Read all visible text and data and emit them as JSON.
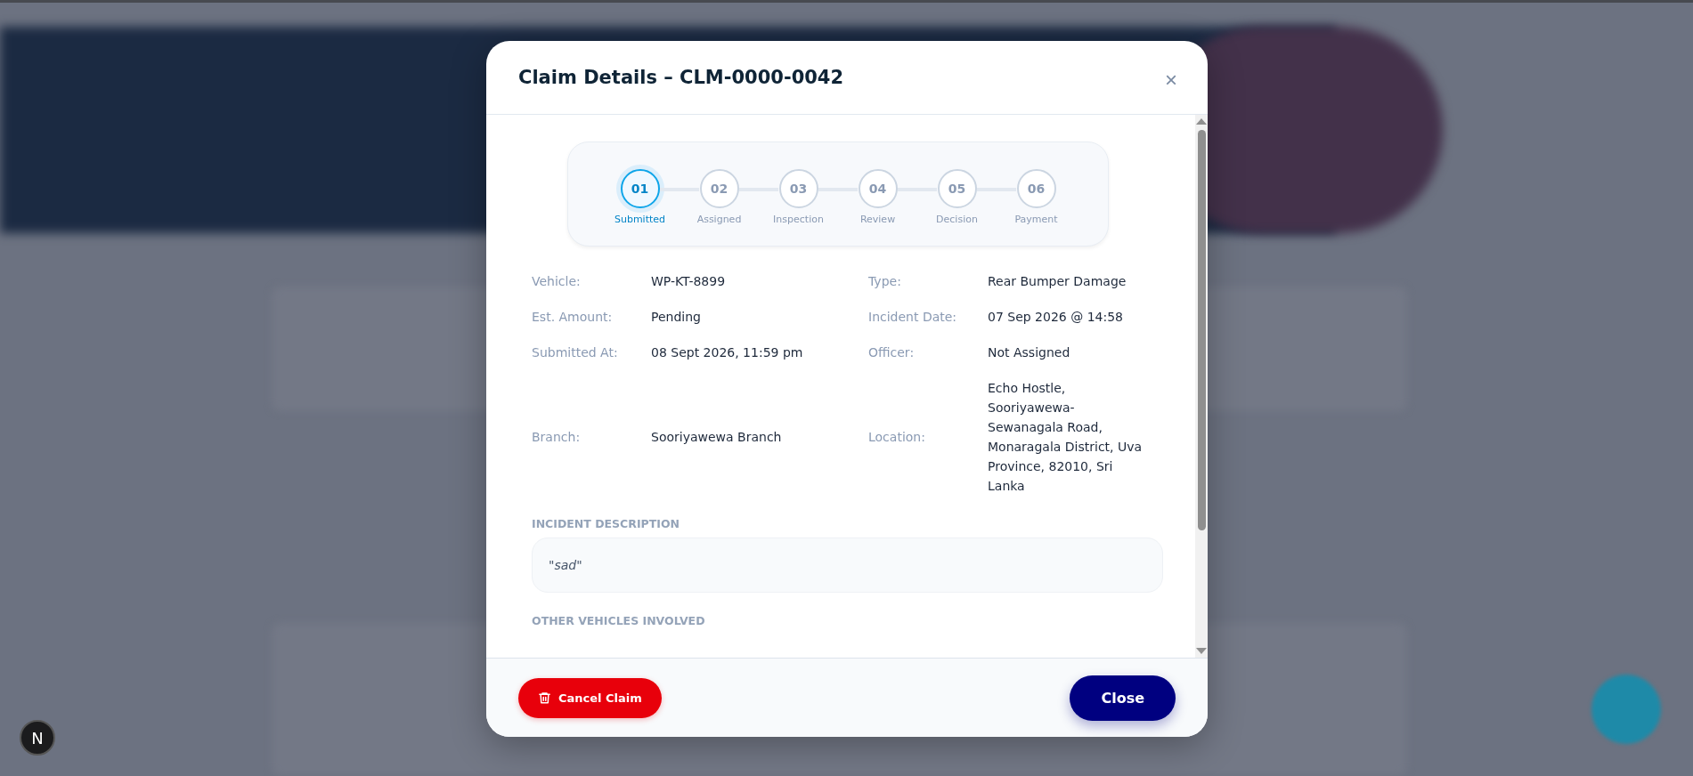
{
  "dev_badge": "N",
  "modal": {
    "title": "Claim Details – CLM-0000-0042",
    "close_icon": "×",
    "steps": [
      {
        "number": "01",
        "label": "Submitted",
        "selected": true
      },
      {
        "number": "02",
        "label": "Assigned",
        "selected": false
      },
      {
        "number": "03",
        "label": "Inspection",
        "selected": false
      },
      {
        "number": "04",
        "label": "Review",
        "selected": false
      },
      {
        "number": "05",
        "label": "Decision",
        "selected": false
      },
      {
        "number": "06",
        "label": "Payment",
        "selected": false
      }
    ],
    "details": [
      [
        {
          "label": "Vehicle:",
          "value": "WP-KT-8899"
        },
        {
          "label": "Type:",
          "value": "Rear Bumper Damage"
        }
      ],
      [
        {
          "label": "Est. Amount:",
          "value": "Pending"
        },
        {
          "label": "Incident Date:",
          "value": "07 Sep 2026 @ 14:58"
        }
      ],
      [
        {
          "label": "Submitted At:",
          "value": "08 Sept 2026, 11:59 pm"
        },
        {
          "label": "Officer:",
          "value": "Not Assigned"
        }
      ],
      [
        {
          "label": "Branch:",
          "value": "Sooriyawewa Branch"
        },
        {
          "label": "Location:",
          "value": "Echo Hostle, Sooriyawewa-Sewanagala Road, Monaragala District, Uva Province, 82010, Sri Lanka"
        }
      ]
    ],
    "description_heading": "INCIDENT DESCRIPTION",
    "description": "\"sad\"",
    "other_vehicles_heading": "OTHER VEHICLES INVOLVED",
    "cancel_button": "Cancel Claim",
    "close_button": "Close"
  }
}
